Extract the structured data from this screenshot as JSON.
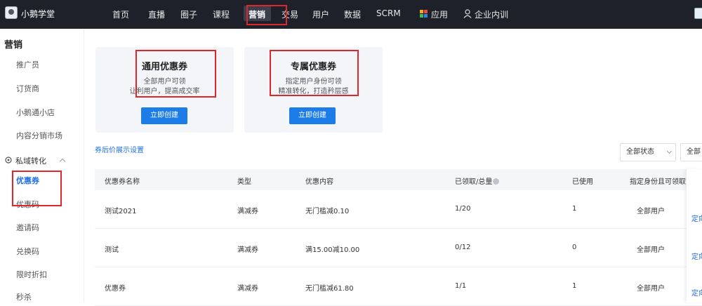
{
  "header": {
    "brand": "小鹅学堂",
    "nav": [
      "首页",
      "直播",
      "圈子",
      "课程",
      "营销",
      "交易",
      "用户",
      "数据",
      "SCRM",
      "应用",
      "企业内训"
    ],
    "active_nav": "营销",
    "app_grid_colors": [
      "#f5a623",
      "#e94b3c",
      "#3dbb61",
      "#2f80ed"
    ],
    "highlight_color": "#e0252b"
  },
  "sidebar": {
    "title": "营销",
    "items": [
      "推广员",
      "订货商",
      "小鹅通小店",
      "内容分销市场"
    ],
    "group": {
      "label": "私域转化",
      "items": [
        "优惠券",
        "优惠码",
        "邀请码",
        "兑换码",
        "限时折扣",
        "秒杀"
      ]
    },
    "active_item": "优惠券"
  },
  "cards": [
    {
      "title": "通用优惠券",
      "desc1": "全部用户可领",
      "desc2": "让利用户，提高成交率",
      "button": "立即创建"
    },
    {
      "title": "专属优惠券",
      "desc1": "指定用户身份可领",
      "desc2": "精准转化，打造矜层感",
      "button": "立即创建"
    }
  ],
  "setting_link": "券后价展示设置",
  "filters": {
    "status": "全部状态",
    "type": "全部"
  },
  "table": {
    "columns": [
      "优惠券名称",
      "类型",
      "优惠内容",
      "已领取/总量",
      "已使用",
      "指定身份且可领取"
    ],
    "rows": [
      {
        "name": "测试2021",
        "type": "满减券",
        "content": "无门槛减0.10",
        "claimed": "1/20",
        "used": "1",
        "scope": "全部用户",
        "op": "定向"
      },
      {
        "name": "测试",
        "type": "满减券",
        "content": "满15.00减10.00",
        "claimed": "0/12",
        "used": "0",
        "scope": "全部用户",
        "op": "定向"
      },
      {
        "name": "优惠券",
        "type": "满减券",
        "content": "无门槛减61.80",
        "claimed": "1/1",
        "used": "1",
        "scope": "全部用户",
        "op": "定向"
      }
    ]
  }
}
